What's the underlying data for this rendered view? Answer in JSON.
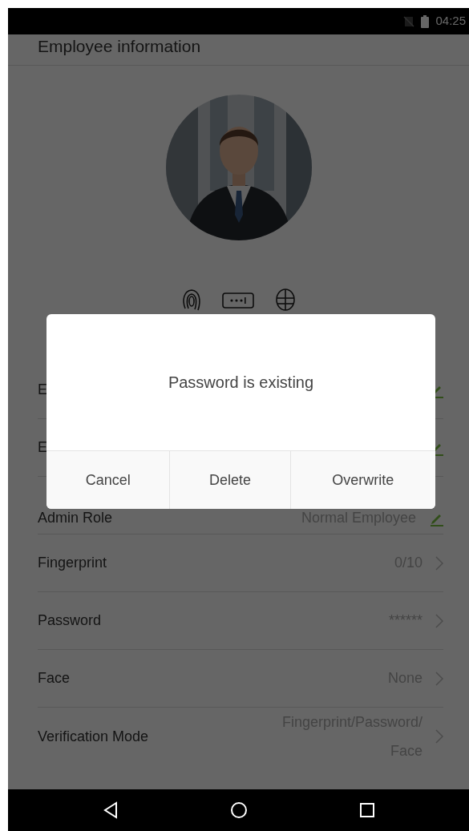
{
  "status_bar": {
    "time": "04:25"
  },
  "header": {
    "title": "Employee information"
  },
  "rows": [
    {
      "kind": "edit",
      "label": "E"
    },
    {
      "kind": "edit",
      "label": "E"
    },
    {
      "kind": "edit",
      "label": "Admin Role",
      "value": "Normal Employee"
    },
    {
      "kind": "link",
      "label": "Fingerprint",
      "value": "0/10"
    },
    {
      "kind": "link",
      "label": "Password",
      "value": "******"
    },
    {
      "kind": "link",
      "label": "Face",
      "value": "None"
    },
    {
      "kind": "link",
      "label": "Verification Mode",
      "value": "Fingerprint/Password/ Face"
    }
  ],
  "dialog": {
    "message": "Password is existing",
    "buttons": [
      "Cancel",
      "Delete",
      "Overwrite"
    ]
  }
}
